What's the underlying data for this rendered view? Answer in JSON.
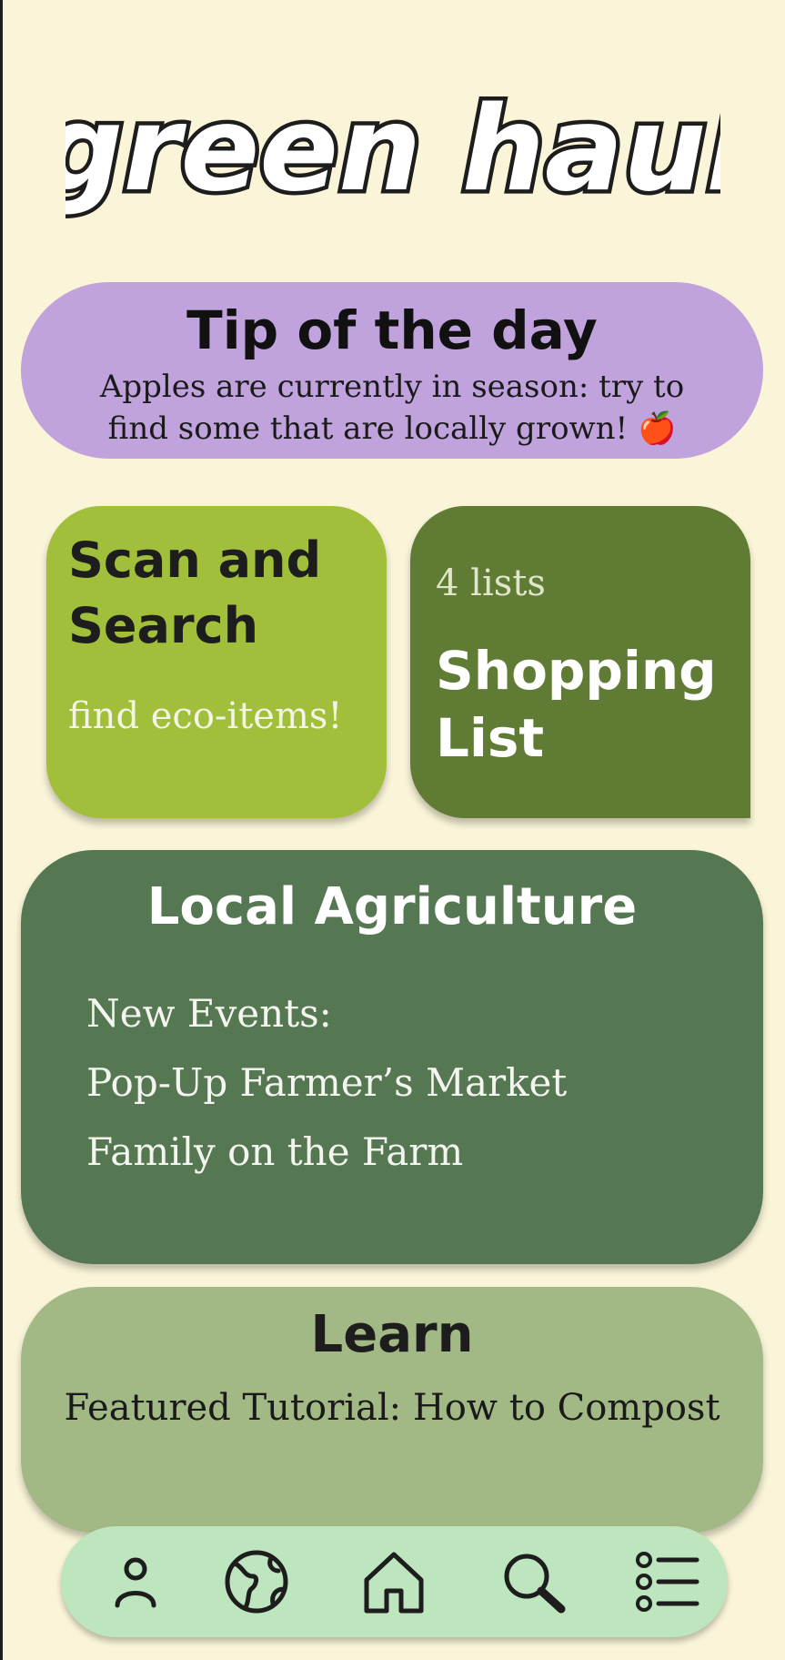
{
  "app": {
    "logo_text": "green haul"
  },
  "tip": {
    "title": "Tip of the day",
    "text": "Apples are currently in season: try to find some that are locally grown! 🍎"
  },
  "scan": {
    "title": "Scan and Search",
    "subtitle": "find eco-items!"
  },
  "shopping": {
    "count": "4 lists",
    "title": "Shopping List"
  },
  "local": {
    "title": "Local Agriculture",
    "items": [
      "New Events:",
      "Pop-Up Farmer’s Market",
      "Family on the Farm"
    ]
  },
  "learn": {
    "title": "Learn",
    "text": "Featured Tutorial: How to Compost"
  },
  "nav": {
    "icons": [
      "profile-icon",
      "globe-icon",
      "home-icon",
      "search-icon",
      "list-icon"
    ]
  },
  "colors": {
    "background": "#faf5d9",
    "tip": "#c0a3dc",
    "scan": "#a1bf3a",
    "shopping": "#5f7b34",
    "local": "#557752",
    "learn": "#a3b985",
    "navbar": "#bde5be"
  }
}
